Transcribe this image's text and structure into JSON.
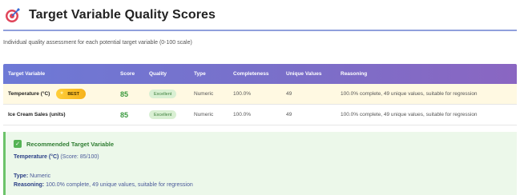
{
  "header": {
    "title": "Target Variable Quality Scores",
    "subtitle": "Individual quality assessment for each potential target variable (0-100 scale)"
  },
  "table": {
    "columns": [
      "Target Variable",
      "Score",
      "Quality",
      "Type",
      "Completeness",
      "Unique Values",
      "Reasoning"
    ],
    "best_badge": "BEST",
    "rows": [
      {
        "name": "Temperature (°C)",
        "score": "85",
        "quality": "Excellent",
        "type": "Numeric",
        "completeness": "100.0%",
        "unique": "49",
        "reasoning": "100.0% complete, 49 unique values, suitable for regression"
      },
      {
        "name": "Ice Cream Sales (units)",
        "score": "85",
        "quality": "Excellent",
        "type": "Numeric",
        "completeness": "100.0%",
        "unique": "49",
        "reasoning": "100.0% complete, 49 unique values, suitable for regression"
      }
    ]
  },
  "recommendation": {
    "title": "Recommended Target Variable",
    "variable": "Temperature (°C)",
    "score_text": "(Score: 85/100)",
    "type_label": "Type:",
    "type_value": "Numeric",
    "reasoning_label": "Reasoning:",
    "reasoning_value": "100.0% complete, 49 unique values, suitable for regression"
  },
  "colors": {
    "accent": "#6d79d6",
    "score_green": "#3a9a3e",
    "best_gold": "#f6b21b",
    "rec_bg": "#ecf8ea"
  },
  "icons": {
    "header": "target-icon",
    "recommendation": "check-icon"
  }
}
